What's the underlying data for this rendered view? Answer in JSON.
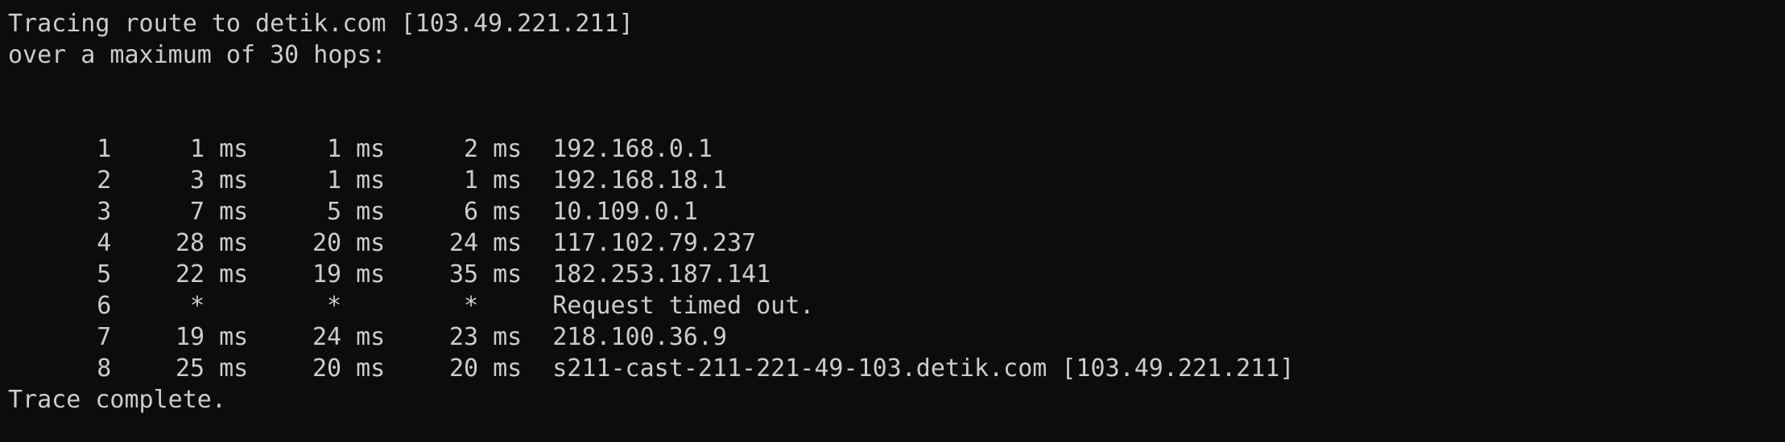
{
  "header": {
    "line1": "Tracing route to detik.com [103.49.221.211]",
    "line2": "over a maximum of 30 hops:"
  },
  "hops": [
    {
      "hop": "1",
      "rtt1": "1 ms",
      "rtt2": "1 ms",
      "rtt3": "2 ms",
      "host": "192.168.0.1"
    },
    {
      "hop": "2",
      "rtt1": "3 ms",
      "rtt2": "1 ms",
      "rtt3": "1 ms",
      "host": "192.168.18.1"
    },
    {
      "hop": "3",
      "rtt1": "7 ms",
      "rtt2": "5 ms",
      "rtt3": "6 ms",
      "host": "10.109.0.1"
    },
    {
      "hop": "4",
      "rtt1": "28 ms",
      "rtt2": "20 ms",
      "rtt3": "24 ms",
      "host": "117.102.79.237"
    },
    {
      "hop": "5",
      "rtt1": "22 ms",
      "rtt2": "19 ms",
      "rtt3": "35 ms",
      "host": "182.253.187.141"
    },
    {
      "hop": "6",
      "rtt1": "*   ",
      "rtt2": "*   ",
      "rtt3": "*   ",
      "host": "Request timed out."
    },
    {
      "hop": "7",
      "rtt1": "19 ms",
      "rtt2": "24 ms",
      "rtt3": "23 ms",
      "host": "218.100.36.9"
    },
    {
      "hop": "8",
      "rtt1": "25 ms",
      "rtt2": "20 ms",
      "rtt3": "20 ms",
      "host": "s211-cast-211-221-49-103.detik.com [103.49.221.211]"
    }
  ],
  "footer": {
    "status": "Trace complete."
  }
}
